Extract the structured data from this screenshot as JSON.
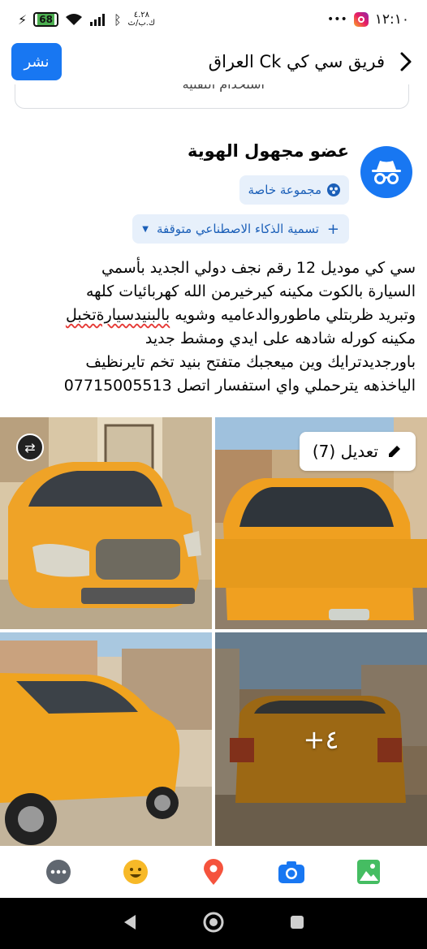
{
  "status_bar": {
    "time": "١٢:١٠",
    "dots": "•••",
    "battery": "68",
    "data_speed": "٤.٢٨\nك.ب/ث"
  },
  "header": {
    "title": "فريق سي كي Ck العراق",
    "publish_label": "نشر"
  },
  "previous_card": {
    "text": "استخدام التقنية"
  },
  "post": {
    "author": "عضو مجهول الهوية",
    "privacy_chip": "مجموعة خاصة",
    "ai_chip": "تسمية الذكاء الاصطناعي متوقفة",
    "ai_chip_plus": "+",
    "text_lines": [
      "سي كي موديل 12 رقم نجف دولي الجديد بأسمي",
      "السيارة بالكوت مكينه كيرخيرمن الله  كهربائيات كلهه",
      "مكينه كورله شادهه على ايدي ومشط جديد",
      "باورجديدترايك وين ميعجبك متفتح بنيد تخم تايرنظيف",
      "الياخذهه يترحملي واي استفسار اتصل 07715005513"
    ],
    "line3_part1": "وتبريد ظربتلي ماطوروالدعاميه وشويه ",
    "line3_wavy": "بالبنيدسيارةتخبل"
  },
  "photos": {
    "edit_label": "تعديل (7)",
    "more_label": "+٤"
  },
  "colors": {
    "brand_blue": "#1877f2",
    "chip_bg": "#e7f0fb",
    "taxi_yellow": "#f0a020"
  },
  "toolbar": {
    "icons": [
      "more-icon",
      "emoji-icon",
      "location-icon",
      "camera-icon",
      "photo-icon"
    ]
  }
}
